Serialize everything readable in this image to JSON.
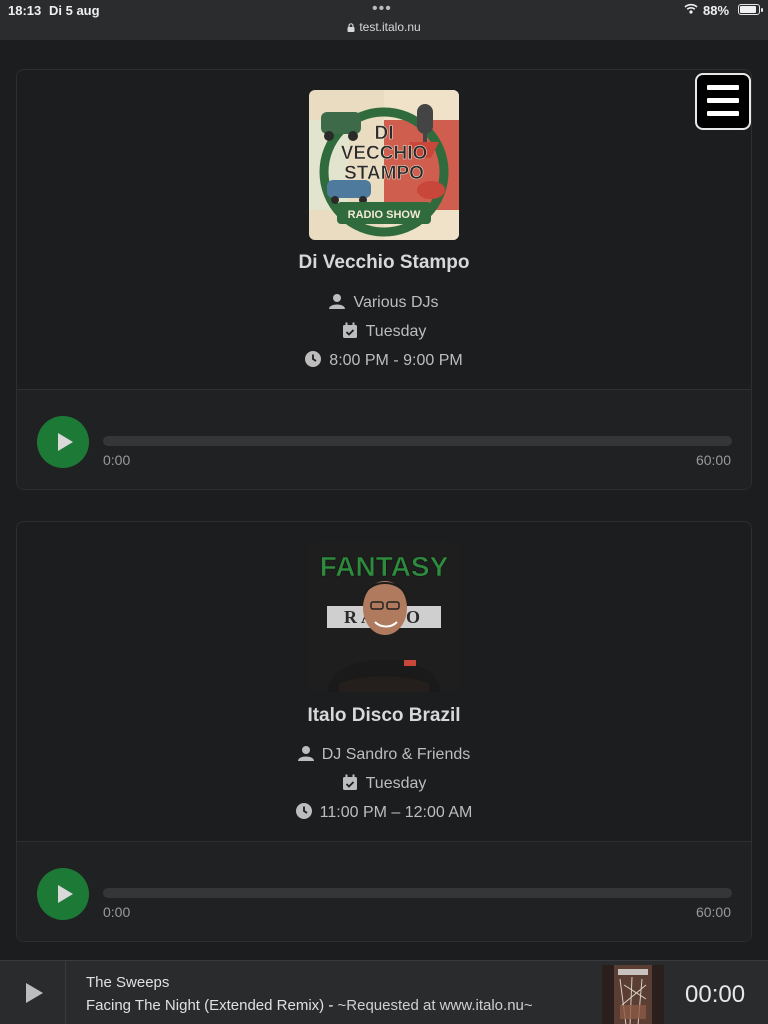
{
  "status_bar": {
    "time": "18:13",
    "date": "Di 5 aug",
    "url": "test.italo.nu",
    "battery": "88%",
    "battery_level": 0.88
  },
  "menu": {
    "icon": "hamburger-menu-icon"
  },
  "shows": [
    {
      "title": "Di Vecchio Stampo",
      "dj": "Various DJs",
      "day": "Tuesday",
      "time": "8:00 PM - 9:00 PM",
      "cover_text": {
        "line1": "DI",
        "line2": "VECCHIO",
        "line3": "STAMPO",
        "ribbon": "RADIO SHOW"
      },
      "player": {
        "current": "0:00",
        "duration": "60:00",
        "progress": 0
      }
    },
    {
      "title": "Italo Disco Brazil",
      "dj": "DJ Sandro & Friends",
      "day": "Tuesday",
      "time": "11:00 PM – 12:00 AM",
      "cover_text": {
        "line1": "FANTASY",
        "line2": "RADIO"
      },
      "player": {
        "current": "0:00",
        "duration": "60:00",
        "progress": 0
      }
    }
  ],
  "now_playing": {
    "artist": "The Sweeps",
    "title": "Facing The Night (Extended Remix)",
    "separator": " - ",
    "request_note": "~Requested at www.italo.nu~",
    "elapsed": "00:00"
  },
  "colors": {
    "background": "#1c1d1f",
    "play_green": "#1d7a36",
    "card_border": "#2c2e31"
  }
}
